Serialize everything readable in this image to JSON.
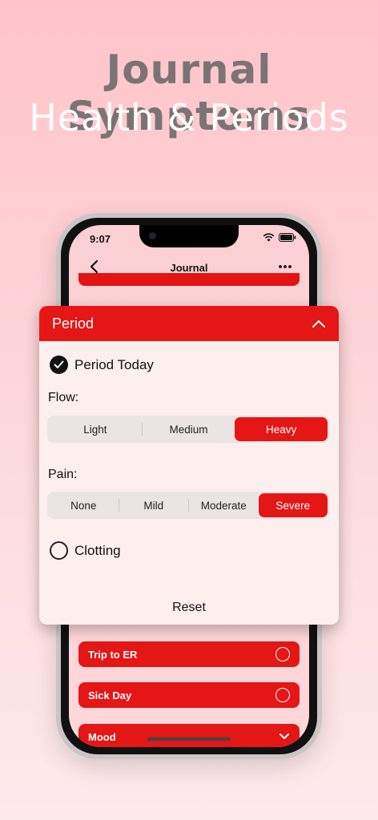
{
  "hero": {
    "title": "Journal Symptoms",
    "subtitle": "Health & Periods"
  },
  "status_bar": {
    "time": "9:07"
  },
  "nav": {
    "title": "Journal"
  },
  "period_card": {
    "title": "Period",
    "period_today": {
      "label": "Period Today",
      "checked": true
    },
    "flow": {
      "label": "Flow:",
      "options": [
        "Light",
        "Medium",
        "Heavy"
      ],
      "selected": "Heavy"
    },
    "pain": {
      "label": "Pain:",
      "options": [
        "None",
        "Mild",
        "Moderate",
        "Severe"
      ],
      "selected": "Severe"
    },
    "clotting": {
      "label": "Clotting",
      "checked": false
    },
    "reset_label": "Reset"
  },
  "journal_rows": [
    {
      "label": "Trip to ER",
      "control": "radio"
    },
    {
      "label": "Sick Day",
      "control": "radio"
    },
    {
      "label": "Mood",
      "control": "chevron"
    }
  ],
  "colors": {
    "accent": "#e41616",
    "card_bg": "#fcefee",
    "headline": "#7b7376"
  }
}
